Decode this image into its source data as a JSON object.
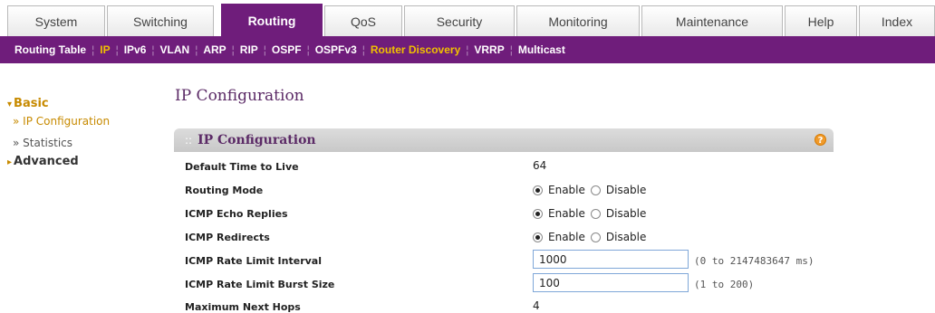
{
  "tabs": [
    {
      "label": "System"
    },
    {
      "label": "Switching"
    },
    {
      "label": "Routing"
    },
    {
      "label": "QoS"
    },
    {
      "label": "Security"
    },
    {
      "label": "Monitoring"
    },
    {
      "label": "Maintenance"
    },
    {
      "label": "Help"
    },
    {
      "label": "Index"
    }
  ],
  "submenu": [
    {
      "label": "Routing Table"
    },
    {
      "label": "IP"
    },
    {
      "label": "IPv6"
    },
    {
      "label": "VLAN"
    },
    {
      "label": "ARP"
    },
    {
      "label": "RIP"
    },
    {
      "label": "OSPF"
    },
    {
      "label": "OSPFv3"
    },
    {
      "label": "Router Discovery"
    },
    {
      "label": "VRRP"
    },
    {
      "label": "Multicast"
    }
  ],
  "leftnav": {
    "basic": "Basic",
    "ip_config": "» IP Configuration",
    "statistics": "» Statistics",
    "advanced": "Advanced"
  },
  "page_title": "IP Configuration",
  "panel": {
    "title": "IP Configuration",
    "help": "?",
    "rows": {
      "ttl_label": "Default Time to Live",
      "ttl_value": "64",
      "routing_label": "Routing Mode",
      "echo_label": "ICMP Echo Replies",
      "redirects_label": "ICMP Redirects",
      "rate_interval_label": "ICMP Rate Limit Interval",
      "rate_interval_value": "1000",
      "rate_interval_hint": "(0 to 2147483647 ms)",
      "burst_label": "ICMP Rate Limit Burst Size",
      "burst_value": "100",
      "burst_hint": "(1 to 200)",
      "nexthops_label": "Maximum Next Hops",
      "nexthops_value": "4"
    },
    "enable_label": "Enable",
    "disable_label": "Disable"
  }
}
